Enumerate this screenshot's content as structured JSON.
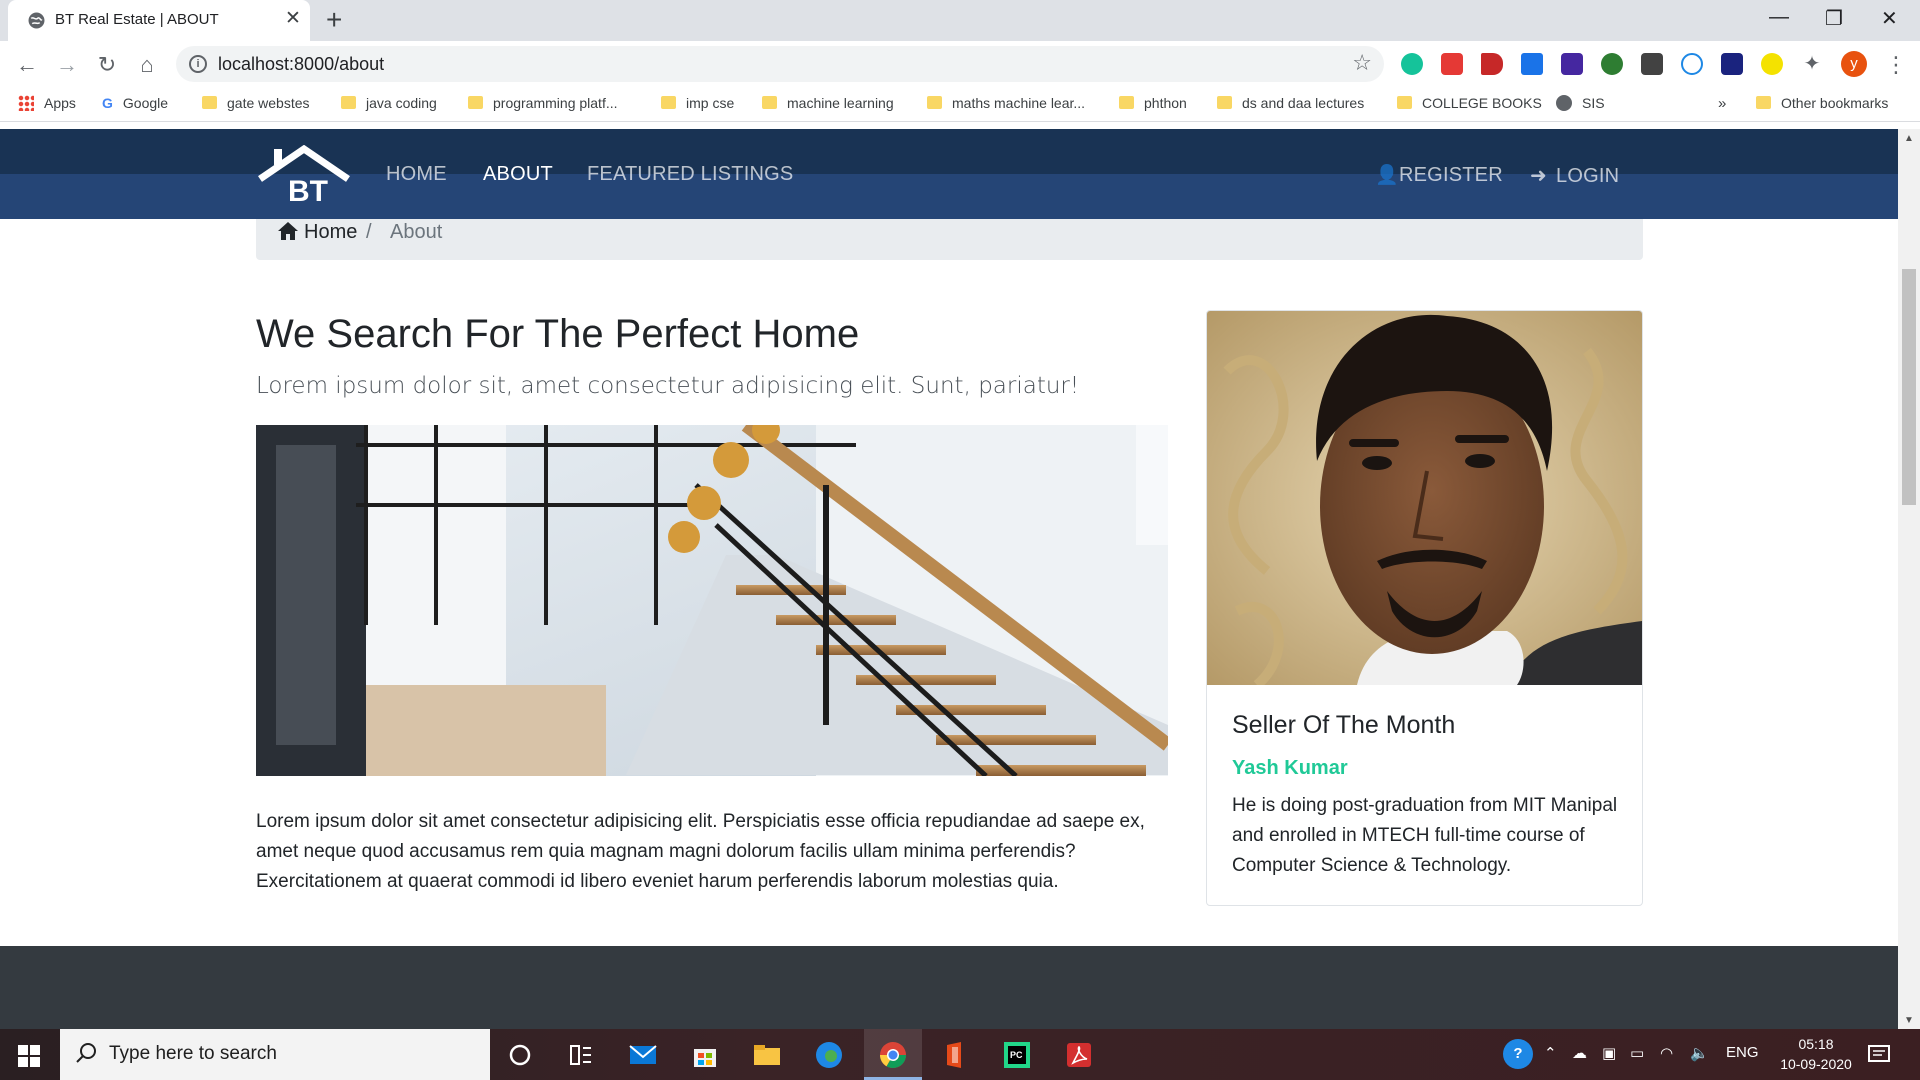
{
  "browser": {
    "tab_title": "BT Real Estate | ABOUT",
    "url": "localhost:8000/about",
    "bookmarks": [
      "Apps",
      "Google",
      "gate webstes",
      "java coding",
      "programming platf...",
      "imp cse",
      "machine learning",
      "maths machine lear...",
      "phthon",
      "ds and daa lectures",
      "COLLEGE BOOKS",
      "SIS"
    ],
    "overflow": "»",
    "other_bookmarks": "Other bookmarks",
    "profile_initial": "y"
  },
  "nav": {
    "logo": "BT",
    "home": "HOME",
    "about": "ABOUT",
    "featured": "FEATURED LISTINGS",
    "register": "REGISTER",
    "login": "LOGIN"
  },
  "breadcrumb": {
    "home": "Home",
    "separator": "/",
    "current": "About"
  },
  "about": {
    "heading": "We Search For The Perfect Home",
    "lead": "Lorem ipsum dolor sit, amet consectetur adipisicing elit. Sunt, pariatur!",
    "body": "Lorem ipsum dolor sit amet consectetur adipisicing elit. Perspiciatis esse officia repudiandae ad saepe ex, amet neque quod accusamus rem quia magnam magni dolorum facilis ullam minima perferendis? Exercitationem at quaerat commodi id libero eveniet harum perferendis laborum molestias quia."
  },
  "seller": {
    "title": "Seller Of The Month",
    "name": "Yash Kumar",
    "description": "He is doing post-graduation from MIT Manipal and enrolled in MTECH full-time course of Computer Science & Technology."
  },
  "taskbar": {
    "search_placeholder": "Type here to search",
    "language": "ENG",
    "time": "05:18",
    "date": "10-09-2020"
  },
  "colors": {
    "nav": "#193354",
    "accent": "#20c997",
    "footer": "#343a40"
  }
}
